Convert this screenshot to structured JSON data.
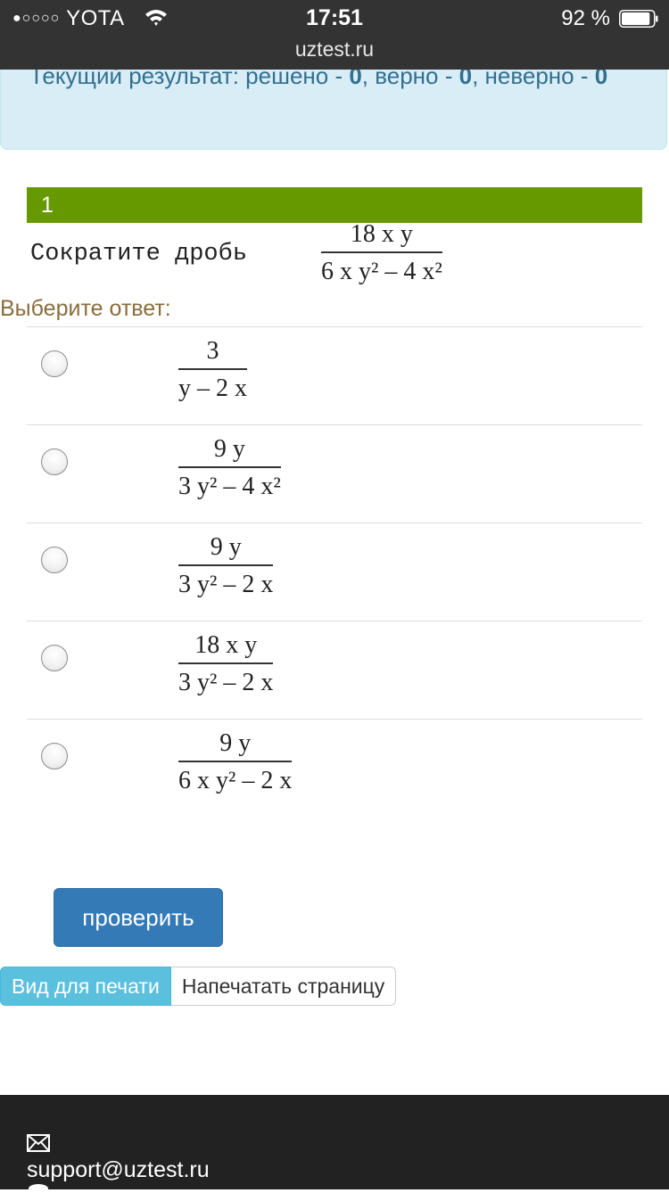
{
  "status_bar": {
    "carrier_dots": "●○○○○",
    "carrier": "YOTA",
    "time": "17:51",
    "battery_percent": "92 %",
    "battery_level": 0.92
  },
  "browser": {
    "url": "uztest.ru"
  },
  "result_panel": {
    "prefix": "Текущий результат: решено - ",
    "solved": "0",
    "correct_label": ", верно - ",
    "correct": "0",
    "incorrect_label": ", неверно - ",
    "incorrect": "0"
  },
  "question": {
    "number": "1",
    "text": "Сократите дробь",
    "fraction": {
      "numerator": "18 x y",
      "denominator": "6 x y² – 4 x²"
    }
  },
  "choose_label": "Выберите ответ:",
  "answers": [
    {
      "numerator": "3",
      "denominator": "y – 2 x"
    },
    {
      "numerator": "9 y",
      "denominator": "3 y² – 4 x²"
    },
    {
      "numerator": "9 y",
      "denominator": "3 y² – 2 x"
    },
    {
      "numerator": "18 x y",
      "denominator": "3 y² – 2 x"
    },
    {
      "numerator": "9 y",
      "denominator": "6 x y² – 2 x"
    }
  ],
  "buttons": {
    "check": "проверить",
    "print_view": "Вид для печати",
    "print_page": "Напечатать страницу"
  },
  "footer": {
    "email": "support@uztest.ru"
  }
}
